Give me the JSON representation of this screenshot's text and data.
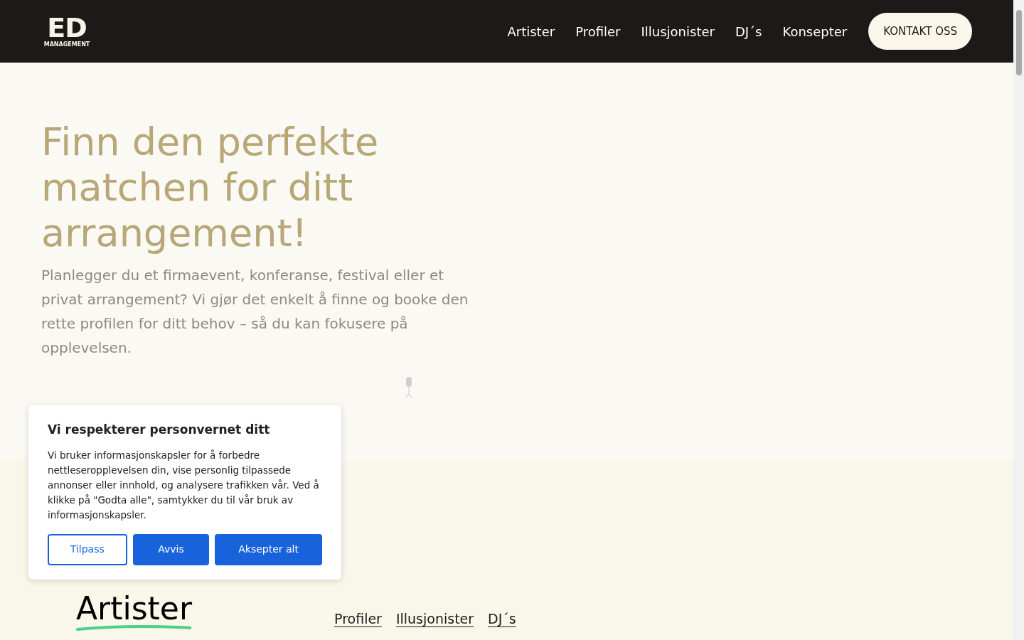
{
  "header": {
    "logo": {
      "letters": "ED",
      "subtitle": "MANAGEMENT"
    },
    "nav": [
      "Artister",
      "Profiler",
      "Illusjonister",
      "DJ´s",
      "Konsepter"
    ],
    "cta": "KONTAKT OSS"
  },
  "hero": {
    "title": "Finn den perfekte matchen for ditt arrangement!",
    "text": "Planlegger du et firmaevent, konferanse, festival eller et privat arrangement? Vi gjør det enkelt å finne og booke den rette profilen for ditt behov – så du kan fokusere på opplevelsen."
  },
  "categories": {
    "tabs": [
      {
        "label": "Artister",
        "selected": true
      },
      {
        "label": "Profiler",
        "selected": false
      },
      {
        "label": "Illusjonister",
        "selected": false
      },
      {
        "label": "DJ´s",
        "selected": false
      }
    ]
  },
  "cookie_banner": {
    "title": "Vi respekterer personvernet ditt",
    "text": "Vi bruker informasjonskapsler for å forbedre nettleseropplevelsen din, vise personlig tilpassede annonser eller innhold, og analysere trafikken vår. Ved å klikke på \"Godta alle\", samtykker du til vår bruk av informasjonskapsler.",
    "buttons": [
      {
        "label": "Tilpass",
        "kind": "outline"
      },
      {
        "label": "Avvis",
        "kind": "filled"
      },
      {
        "label": "Aksepter alt",
        "kind": "filled"
      }
    ]
  }
}
